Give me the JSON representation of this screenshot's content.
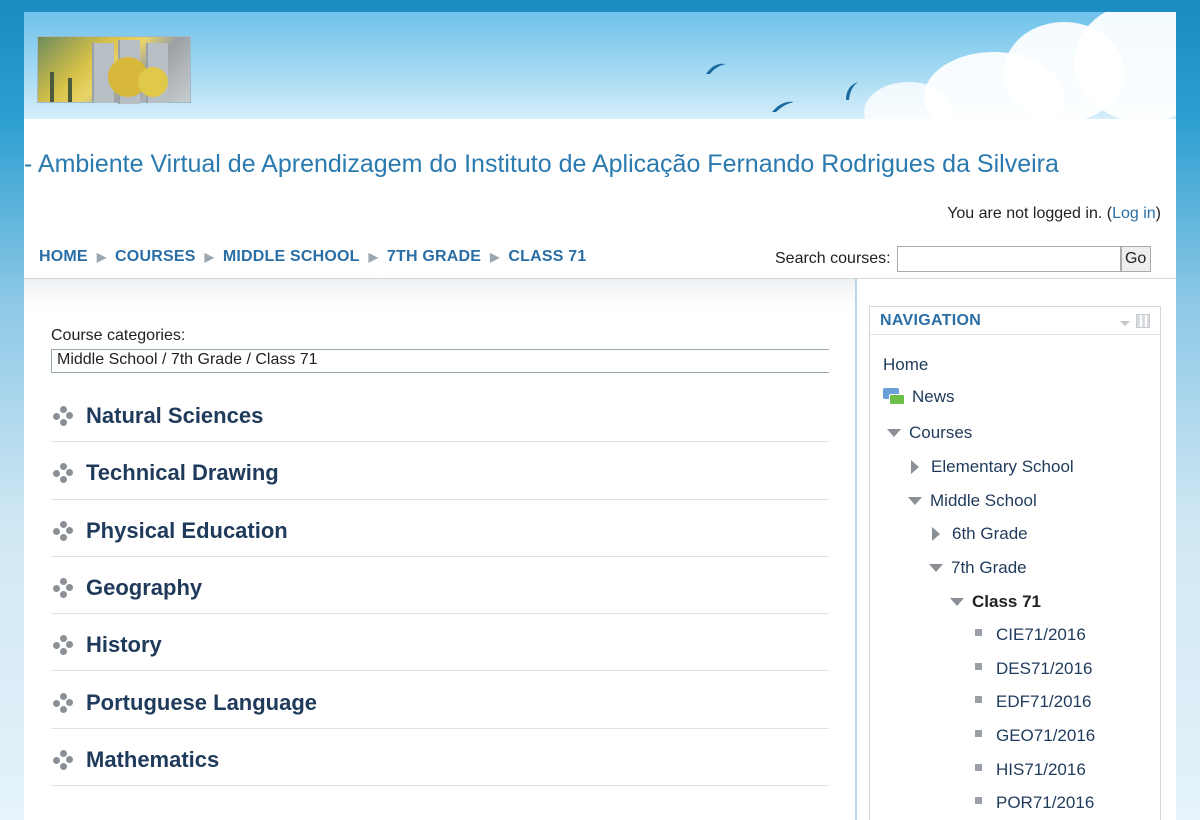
{
  "header": {
    "site_title": "- Ambiente Virtual de Aprendizagem do Instituto de Aplicação Fernando Rodrigues da Silveira",
    "login_text": "You are not logged in. (",
    "login_link": "Log in",
    "login_close": ")"
  },
  "breadcrumb": [
    "HOME",
    "COURSES",
    "MIDDLE SCHOOL",
    "7TH GRADE",
    "CLASS 71"
  ],
  "search": {
    "label": "Search courses:",
    "value": "",
    "button": "Go"
  },
  "main": {
    "category_label": "Course categories:",
    "category_value": "Middle School / 7th Grade / Class 71",
    "courses": [
      "Natural Sciences",
      "Technical Drawing",
      "Physical Education",
      "Geography",
      "History",
      "Portuguese Language",
      "Mathematics"
    ]
  },
  "navigation": {
    "title": "NAVIGATION",
    "home": "Home",
    "news": "News",
    "courses": "Courses",
    "elementary": "Elementary School",
    "middle": "Middle School",
    "grade6": "6th Grade",
    "grade7": "7th Grade",
    "class71": "Class 71",
    "class_courses": [
      "CIE71/2016",
      "DES71/2016",
      "EDF71/2016",
      "GEO71/2016",
      "HIS71/2016",
      "POR71/2016"
    ]
  }
}
